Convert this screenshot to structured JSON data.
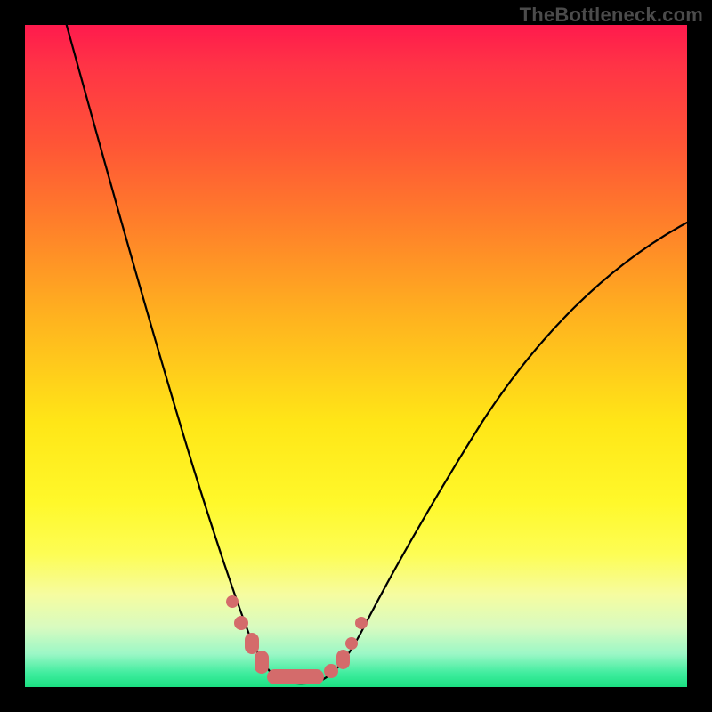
{
  "watermark": "TheBottleneck.com",
  "colors": {
    "frame": "#000000",
    "curve": "#000000",
    "marker": "#d46b6b",
    "gradient_top": "#ff1a4d",
    "gradient_bottom": "#1be082"
  },
  "chart_data": {
    "type": "line",
    "title": "",
    "xlabel": "",
    "ylabel": "",
    "xlim": [
      0,
      100
    ],
    "ylim": [
      0,
      100
    ],
    "grid": false,
    "series": [
      {
        "name": "bottleneck-curve",
        "x": [
          6,
          10,
          14,
          18,
          22,
          25,
          28,
          30,
          32,
          34,
          35,
          37,
          38,
          39,
          40,
          41,
          43,
          45,
          47,
          49,
          51,
          53,
          57,
          62,
          68,
          75,
          83,
          92,
          100
        ],
        "y": [
          100,
          85,
          70,
          56,
          42,
          32,
          22,
          16,
          11,
          7,
          5,
          3,
          2,
          1.2,
          0.8,
          0.6,
          0.5,
          0.6,
          1,
          2,
          4,
          7,
          13,
          22,
          32,
          42,
          52,
          61,
          68
        ],
        "note": "y = bottleneck percentage (0 = perfect match at valley, 100 = full bottleneck); values estimated from curve shape"
      }
    ],
    "markers": {
      "note": "salmon dots/pills along valley region of curve; x in same 0-100 units",
      "points_x": [
        31,
        33,
        34,
        35,
        37,
        38,
        39,
        40,
        41,
        43,
        45,
        46,
        48,
        49,
        50
      ],
      "points_y": [
        12,
        8,
        6,
        4,
        2.5,
        1.6,
        1,
        0.7,
        0.6,
        0.5,
        0.7,
        1.2,
        3,
        5,
        7
      ]
    }
  }
}
